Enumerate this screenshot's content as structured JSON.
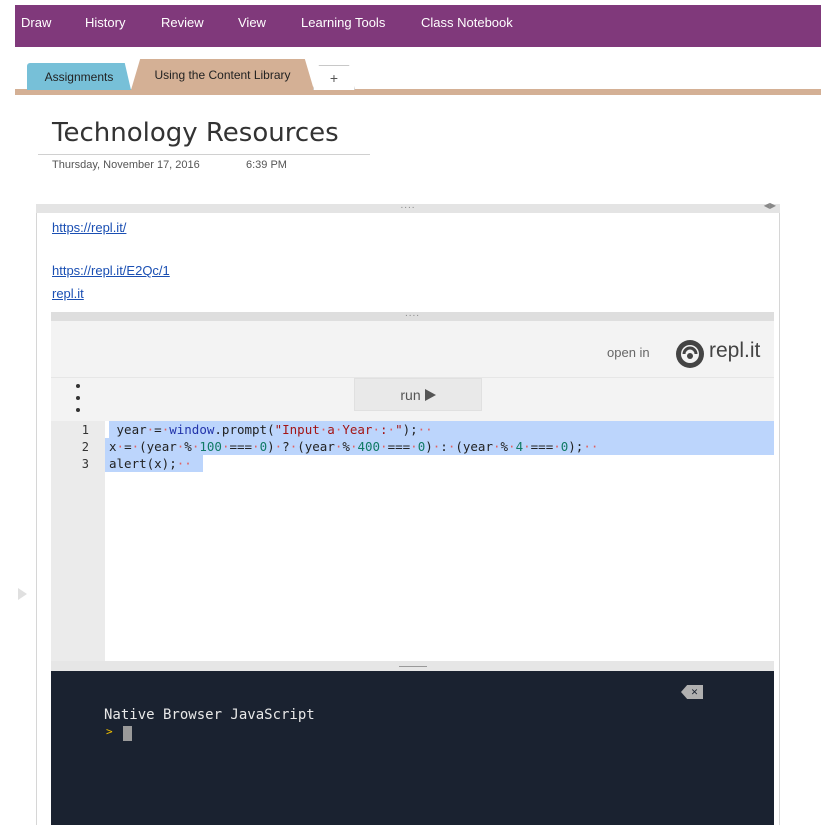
{
  "ribbon": {
    "tabs": [
      "Draw",
      "History",
      "Review",
      "View",
      "Learning Tools",
      "Class Notebook"
    ]
  },
  "sections": {
    "tab_assignments": "Assignments",
    "tab_content_library": "Using the Content Library",
    "add_tab": "+"
  },
  "page": {
    "title": "Technology Resources",
    "date": "Thursday, November 17, 2016",
    "time": "6:39 PM"
  },
  "links": {
    "link1": "https://repl.it/",
    "link2": "https://repl.it/E2Qc/1",
    "link3": "repl.it"
  },
  "embed": {
    "handle": "....",
    "open_in": "open in",
    "brand": "repl.it",
    "run_label": "run",
    "line_numbers": [
      "1",
      "2",
      "3"
    ],
    "console_title": "Native Browser JavaScript",
    "console_prompt": ">"
  },
  "colors": {
    "ribbon_bg": "#80397b",
    "tab_assignments": "#77c0d8",
    "tab_content": "#d4b095",
    "console_bg": "#1a2230",
    "selection": "#bcd5fc",
    "link": "#1a4fb3"
  }
}
